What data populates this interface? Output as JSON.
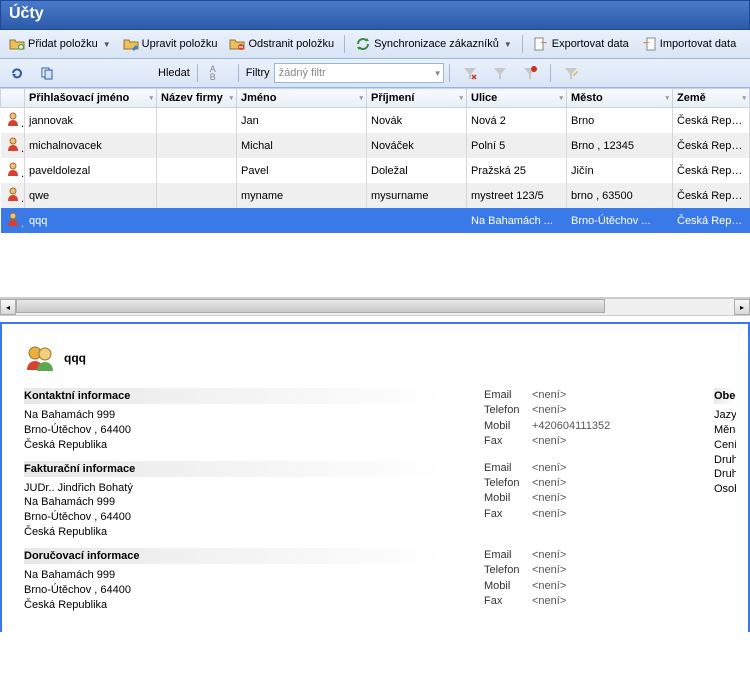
{
  "title": "Účty",
  "toolbar": {
    "add": "Přidat položku",
    "edit": "Upravit položku",
    "remove": "Odstranit položku",
    "sync": "Synchronizace zákazníků",
    "export": "Exportovat data",
    "import": "Importovat data",
    "search": "Hledat",
    "filters": "Filtry",
    "filter_placeholder": "žádný filtr"
  },
  "columns": [
    "Přihlašovací jméno",
    "Název firmy",
    "Jméno",
    "Příjmení",
    "Ulice",
    "Město",
    "Země"
  ],
  "rows": [
    {
      "login": "jannovak",
      "company": "",
      "first": "Jan",
      "last": "Novák",
      "street": "Nová 2",
      "city": "Brno",
      "country": "Česká Republika"
    },
    {
      "login": "michalnovacek",
      "company": "",
      "first": "Michal",
      "last": "Nováček",
      "street": "Polní 5",
      "city": "Brno , 12345",
      "country": "Česká Republika"
    },
    {
      "login": "paveldolezal",
      "company": "",
      "first": "Pavel",
      "last": "Doležal",
      "street": "Pražská 25",
      "city": "Jičín",
      "country": "Česká Republika"
    },
    {
      "login": "qwe",
      "company": "",
      "first": "myname",
      "last": "mysurname",
      "street": "mystreet 123/5",
      "city": "brno , 63500",
      "country": "Česká Republika"
    },
    {
      "login": "qqq",
      "company": "",
      "first": "",
      "last": "",
      "street": "Na Bahamách ...",
      "city": "Brno-Útěchov ...",
      "country": "Česká Republik"
    }
  ],
  "selected_index": 4,
  "detail": {
    "username": "qqq",
    "sections": {
      "contact": {
        "title": "Kontaktní informace",
        "lines": [
          "Na Bahamách 999",
          "Brno-Útěchov , 64400",
          "Česká Republika"
        ],
        "email": "<není>",
        "phone": "<není>",
        "mobile": "+420604111352",
        "fax": "<není>"
      },
      "billing": {
        "title": "Fakturační informace",
        "lines": [
          "JUDr.. Jindřich Bohatý",
          "Na Bahamách 999",
          "Brno-Útěchov , 64400",
          "Česká Republika"
        ],
        "email": "<není>",
        "phone": "<není>",
        "mobile": "<není>",
        "fax": "<není>"
      },
      "shipping": {
        "title": "Doručovací informace",
        "lines": [
          "Na Bahamách 999",
          "Brno-Útěchov , 64400",
          "Česká Republika"
        ],
        "email": "<není>",
        "phone": "<není>",
        "mobile": "<není>",
        "fax": "<není>"
      }
    },
    "labels": {
      "email": "Email",
      "phone": "Telefon",
      "mobile": "Mobil",
      "fax": "Fax"
    },
    "side": {
      "title": "Obecn",
      "items": [
        "Jazyk",
        "Měna",
        "Ceník",
        "Druh p",
        "Druh o",
        "Osob"
      ]
    }
  }
}
